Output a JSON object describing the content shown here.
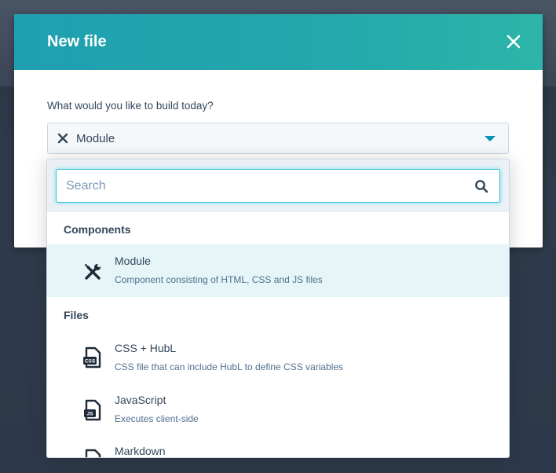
{
  "modal": {
    "title": "New file",
    "field_label": "What would you like to build today?",
    "select": {
      "value": "Module"
    }
  },
  "dropdown": {
    "search": {
      "placeholder": "Search"
    },
    "groups": [
      {
        "heading": "Components",
        "options": [
          {
            "title": "Module",
            "description": "Component consisting of HTML, CSS and JS files",
            "icon": "tools-icon",
            "selected": true
          }
        ]
      },
      {
        "heading": "Files",
        "options": [
          {
            "title": "CSS + HubL",
            "description": "CSS file that can include HubL to define CSS variables",
            "icon": "css-file-icon",
            "badge": "CSS"
          },
          {
            "title": "JavaScript",
            "description": "Executes client-side",
            "icon": "js-file-icon",
            "badge": "JS"
          },
          {
            "title": "Markdown",
            "description": "",
            "icon": "markdown-file-icon"
          }
        ]
      }
    ]
  },
  "colors": {
    "header_gradient_start": "#1f9fb0",
    "header_gradient_end": "#2cb5a8",
    "accent": "#0091ae",
    "selected_row": "#e5f5f8",
    "text_primary": "#33475b",
    "text_secondary": "#516f90"
  }
}
